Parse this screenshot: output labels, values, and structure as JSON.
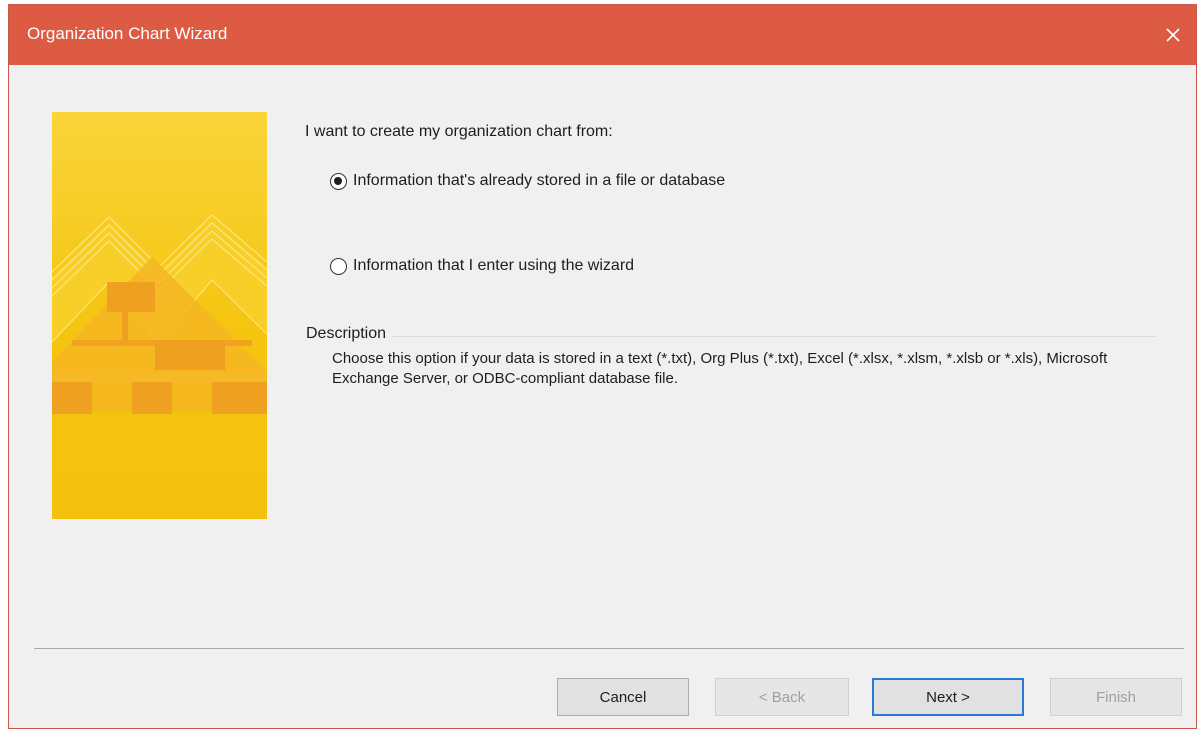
{
  "window": {
    "title": "Organization Chart Wizard",
    "close_icon": "close-icon"
  },
  "banner": {
    "icon": "org-chart-banner"
  },
  "main": {
    "heading": "I want to create my organization chart from:",
    "options": [
      {
        "label": "Information that's already stored in a file or database",
        "selected": true
      },
      {
        "label": "Information that I enter using the wizard",
        "selected": false
      }
    ],
    "description_label": "Description",
    "description_text": "Choose this option if your data is stored in a text (*.txt), Org Plus (*.txt), Excel (*.xlsx, *.xlsm, *.xlsb or *.xls), Microsoft Exchange Server, or ODBC-compliant database file."
  },
  "buttons": {
    "cancel": "Cancel",
    "back": "< Back",
    "next": "Next >",
    "finish": "Finish"
  },
  "colors": {
    "titlebar": "#de5b43",
    "banner_yellow": "#f6c918",
    "banner_orange": "#f2a21a",
    "default_button_border": "#2b79d6"
  }
}
